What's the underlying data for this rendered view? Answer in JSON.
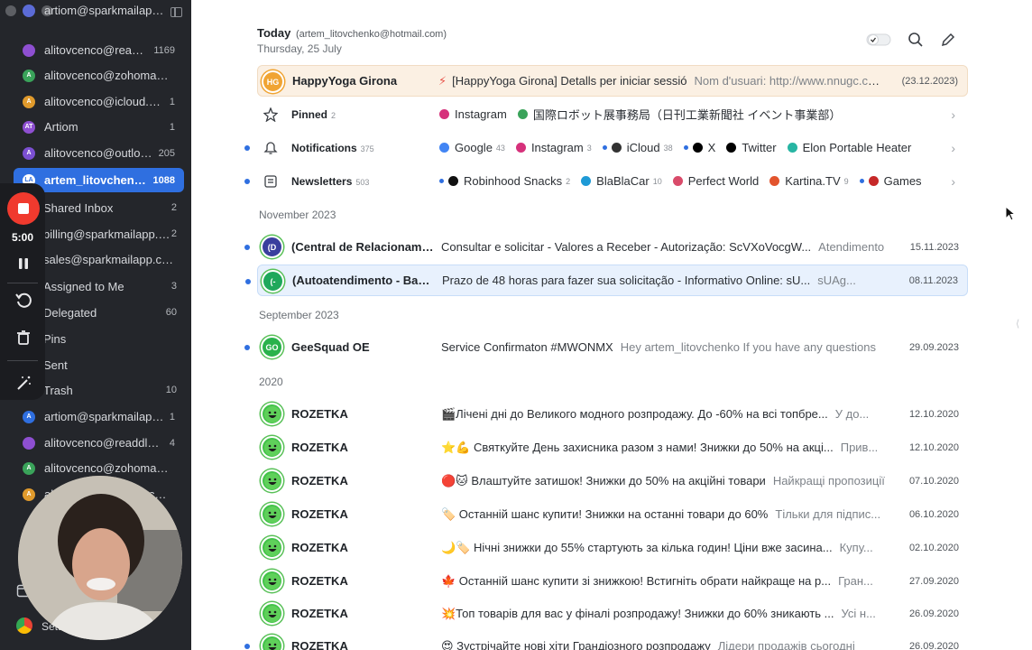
{
  "sidebar": {
    "accounts": [
      {
        "name": "artiom@sparkmailapp.com",
        "count": "",
        "color": "#5b6bd6",
        "initials": ""
      },
      {
        "name": "alitovcenco@readdle.com",
        "count": "1169",
        "color": "#8e4fd1",
        "initials": ""
      },
      {
        "name": "alitovcenco@zohomail.eu",
        "count": "",
        "color": "#3aa35a",
        "initials": "A"
      },
      {
        "name": "alitovcenco@icloud.com",
        "count": "1",
        "color": "#e09a2c",
        "initials": "A"
      },
      {
        "name": "Artiom",
        "count": "1",
        "color": "#8e4fd1",
        "initials": "AT"
      },
      {
        "name": "alitovcenco@outlook.com",
        "count": "205",
        "color": "#7b4fd1",
        "initials": "A"
      },
      {
        "name": "artem_litovchenko@hotmail.com",
        "count": "1088",
        "color": "#2f6fe0",
        "initials": "LA"
      }
    ],
    "folders": [
      {
        "name": "Shared Inbox",
        "count": "2"
      },
      {
        "name": "billing@sparkmailapp.com",
        "count": "2"
      },
      {
        "name": "sales@sparkmailapp.com",
        "count": ""
      },
      {
        "name": "Assigned to Me",
        "count": "3"
      },
      {
        "name": "Delegated",
        "count": "60"
      },
      {
        "name": "Pins",
        "count": ""
      },
      {
        "name": "Sent",
        "count": ""
      },
      {
        "name": "Trash",
        "count": "10"
      }
    ],
    "accounts2": [
      {
        "name": "artiom@sparkmailapp.com",
        "count": "1",
        "color": "#2f6fe0",
        "initials": "A"
      },
      {
        "name": "alitovcenco@readdle.com",
        "count": "4",
        "color": "#8e4fd1",
        "initials": ""
      },
      {
        "name": "alitovcenco@zohomail.eu",
        "count": "",
        "color": "#3aa35a",
        "initials": "A"
      },
      {
        "name": "alitovcenco@icloud.com",
        "count": "",
        "color": "#e09a2c",
        "initials": "A"
      }
    ],
    "settings_label": "Settings"
  },
  "recorder": {
    "time": "5:00"
  },
  "header": {
    "title": "Today",
    "email": "(artem_litovchenko@hotmail.com)",
    "date": "Thursday, 25 July"
  },
  "pinned_row": {
    "initials": "HG",
    "sender": "HappyYoga Girona",
    "subject": "[HappyYoga Girona] Detalls per iniciar sessió",
    "preview": "Nom d'usuari: http://www.nnugc.com/account/reset/ZT",
    "date": "(23.12.2023)"
  },
  "groups": [
    {
      "name": "Pinned",
      "count": "2",
      "items": [
        {
          "label": "Instagram",
          "count": "",
          "color": "#d6317b",
          "dot": false
        },
        {
          "label": "国際ロボット展事務局（日刊工業新聞社 イベント事業部）",
          "count": "",
          "color": "#3aa35a",
          "dot": false
        }
      ]
    },
    {
      "name": "Notifications",
      "count": "375",
      "items": [
        {
          "label": "Google",
          "count": "43",
          "color": "#4285f4",
          "dot": false
        },
        {
          "label": "Instagram",
          "count": "3",
          "color": "#d6317b",
          "dot": false
        },
        {
          "label": "iCloud",
          "count": "38",
          "color": "#333333",
          "dot": true
        },
        {
          "label": "X",
          "count": "",
          "color": "#000000",
          "dot": true
        },
        {
          "label": "Twitter",
          "count": "",
          "color": "#000000",
          "dot": false
        },
        {
          "label": "Elon Portable Heater",
          "count": "",
          "color": "#27b5a3",
          "dot": false
        }
      ]
    },
    {
      "name": "Newsletters",
      "count": "503",
      "items": [
        {
          "label": "Robinhood Snacks",
          "count": "2",
          "color": "#111111",
          "dot": true
        },
        {
          "label": "BlaBlaCar",
          "count": "10",
          "color": "#1e9ad6",
          "dot": false
        },
        {
          "label": "Perfect World",
          "count": "",
          "color": "#d94b6a",
          "dot": false
        },
        {
          "label": "Kartina.TV",
          "count": "9",
          "color": "#e2542d",
          "dot": false
        },
        {
          "label": "Games",
          "count": "",
          "color": "#c62828",
          "dot": true
        }
      ]
    }
  ],
  "sections": [
    {
      "title": "November 2023",
      "emails": [
        {
          "initials": "(D",
          "avatar": "#3a3f9e",
          "sender": "(Central de Relacionamento)",
          "subject": "Consultar e solicitar - Valores a Receber - Autorização: ScVXoVocgW...",
          "preview": "Atendimento",
          "date": "15.11.2023",
          "unread": true,
          "selected": false
        },
        {
          "initials": "(-",
          "avatar": "#1fa85b",
          "sender": "(Autoatendimento - Banco)",
          "subject": "Prazo de 48 horas para fazer sua solicitação - Informativo Online: sU...",
          "preview": "sUAg...",
          "date": "08.11.2023",
          "unread": true,
          "selected": true
        }
      ]
    },
    {
      "title": "September 2023",
      "emails": [
        {
          "initials": "GO",
          "avatar": "#2ab24c",
          "sender": "GeeSquad OE",
          "subject": "Service Confirmaton #MWONMX",
          "preview": "Hey artem_litovchenko If you have any questions",
          "date": "29.09.2023",
          "unread": true,
          "selected": false
        }
      ]
    },
    {
      "title": "2020",
      "emails": [
        {
          "initials": "",
          "avatar": "#43c24a",
          "sender": "ROZETKA",
          "subject": "🎬Лічені дні до Великого модного розпродажу. До -60% на всі топбре...",
          "preview": "У до...",
          "date": "12.10.2020",
          "unread": false,
          "selected": false
        },
        {
          "initials": "",
          "avatar": "#43c24a",
          "sender": "ROZETKA",
          "subject": "⭐💪 Святкуйте День захисника разом з нами! Знижки до 50% на акці...",
          "preview": "Прив...",
          "date": "12.10.2020",
          "unread": false,
          "selected": false
        },
        {
          "initials": "",
          "avatar": "#43c24a",
          "sender": "ROZETKA",
          "subject": "🔴🐱 Влаштуйте затишок! Знижки до 50% на акційні товари",
          "preview": "Найкращі пропозиції",
          "date": "07.10.2020",
          "unread": false,
          "selected": false
        },
        {
          "initials": "",
          "avatar": "#43c24a",
          "sender": "ROZETKA",
          "subject": "🏷️ Останній шанс купити! Знижки на останні товари до 60%",
          "preview": "Тільки для підпис...",
          "date": "06.10.2020",
          "unread": false,
          "selected": false
        },
        {
          "initials": "",
          "avatar": "#43c24a",
          "sender": "ROZETKA",
          "subject": "🌙🏷️ Нічні знижки до 55% стартують за кілька годин! Ціни вже засина...",
          "preview": "Купу...",
          "date": "02.10.2020",
          "unread": false,
          "selected": false
        },
        {
          "initials": "",
          "avatar": "#43c24a",
          "sender": "ROZETKA",
          "subject": "🍁 Останній шанс купити зі знижкою! Встигніть обрати найкраще на р...",
          "preview": "Гран...",
          "date": "27.09.2020",
          "unread": false,
          "selected": false
        },
        {
          "initials": "",
          "avatar": "#43c24a",
          "sender": "ROZETKA",
          "subject": "💥Топ товарів для вас у фіналі розпродажу! Знижки до 60% зникають ...",
          "preview": "Усі н...",
          "date": "26.09.2020",
          "unread": false,
          "selected": false
        },
        {
          "initials": "",
          "avatar": "#43c24a",
          "sender": "ROZETKA",
          "subject": "😍 Зустрічайте нові хіти Грандіозного розпродажу",
          "preview": "Лідери продажів сьогодні",
          "date": "26.09.2020",
          "unread": true,
          "selected": false
        }
      ]
    }
  ]
}
